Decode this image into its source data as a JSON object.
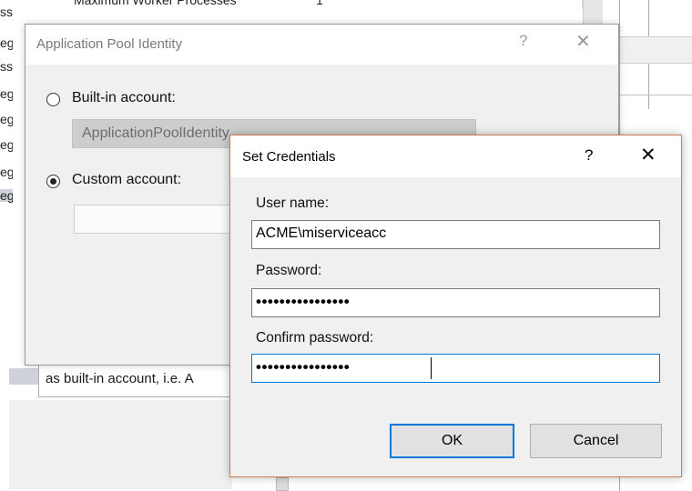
{
  "background": {
    "left_column_fragments": [
      "ss",
      "eg",
      "ss",
      "eg",
      "eg",
      "eg",
      "eg",
      "eg"
    ],
    "top_row_label": "Maximum Worker Processes",
    "top_row_value": "1",
    "description_text": "as built-in account, i.e. A"
  },
  "app_pool_identity": {
    "title": "Application Pool Identity",
    "help": "?",
    "close": "✕",
    "builtin_label": "Built-in account:",
    "builtin_value": "ApplicationPoolIdentity",
    "custom_label": "Custom account:",
    "selected_option": "custom"
  },
  "set_credentials": {
    "title": "Set Credentials",
    "help": "?",
    "close": "✕",
    "username_label": "User name:",
    "username_value": "ACME\\miserviceacc",
    "password_label": "Password:",
    "password_masked": "••••••••••••••••",
    "confirm_label": "Confirm password:",
    "confirm_masked": "••••••••••••••••",
    "ok_label": "OK",
    "cancel_label": "Cancel",
    "accent_color": "#0078d7",
    "border_color": "#c67a52"
  }
}
